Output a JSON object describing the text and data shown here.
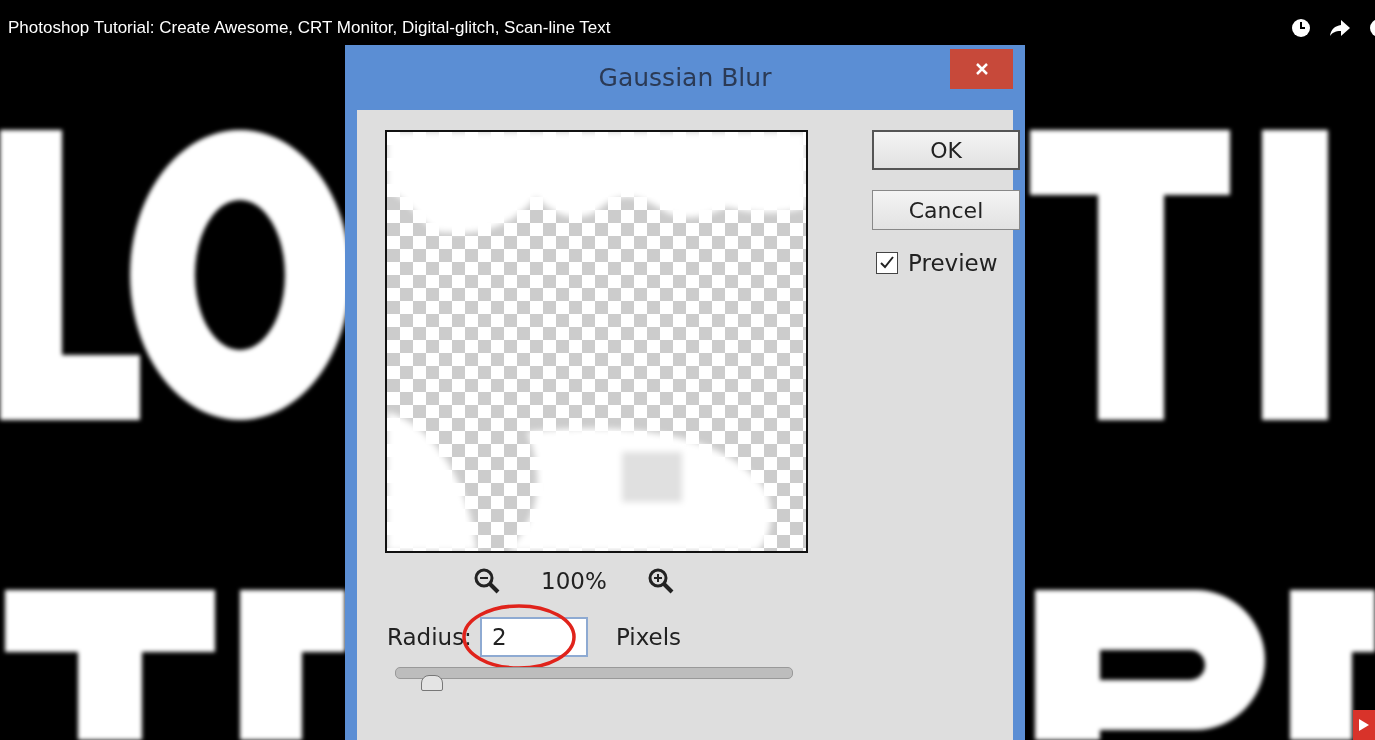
{
  "video": {
    "title": "Photoshop Tutorial: Create Awesome, CRT Monitor, Digital-glitch, Scan-line Text"
  },
  "dialog": {
    "title": "Gaussian Blur",
    "zoom": "100%",
    "radius_label": "Radius:",
    "radius_value": "2",
    "unit": "Pixels",
    "buttons": [
      "OK",
      "Cancel"
    ],
    "preview": {
      "label": "Preview",
      "checked": true
    },
    "slider": {
      "level": 0.09
    }
  }
}
